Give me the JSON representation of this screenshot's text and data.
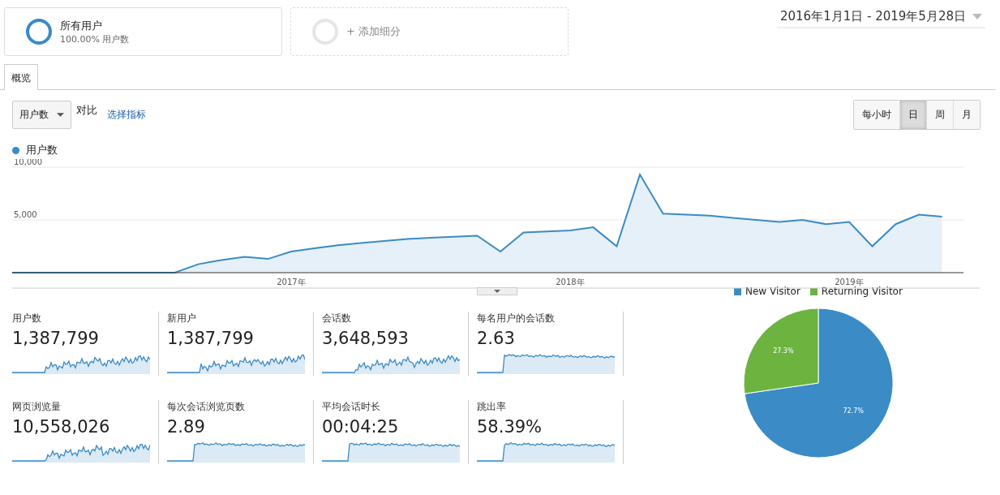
{
  "segments": [
    {
      "kind": "active",
      "title": "所有用户",
      "subtitle": "100.00% 用户数"
    },
    {
      "kind": "add",
      "title": "+ 添加细分"
    }
  ],
  "date_range": "2016年1月1日 - 2019年5月28日",
  "tabs": [
    {
      "label": "概览",
      "selected": true
    }
  ],
  "metric_dropdown": "用户数",
  "compare_label": "对比",
  "select_metric_link": "选择指标",
  "granularity": [
    {
      "label": "每小时",
      "selected": false
    },
    {
      "label": "日",
      "selected": true
    },
    {
      "label": "周",
      "selected": false
    },
    {
      "label": "月",
      "selected": false
    }
  ],
  "main_chart": {
    "chart_data": {
      "type": "area",
      "x": [
        2016,
        2016.083,
        2016.167,
        2016.25,
        2016.333,
        2016.417,
        2016.5,
        2016.583,
        2016.667,
        2016.75,
        2016.833,
        2016.917,
        2017,
        2017.083,
        2017.167,
        2017.25,
        2017.333,
        2017.417,
        2017.5,
        2017.583,
        2017.667,
        2017.75,
        2017.833,
        2017.917,
        2018,
        2018.083,
        2018.167,
        2018.25,
        2018.333,
        2018.417,
        2018.5,
        2018.583,
        2018.667,
        2018.75,
        2018.833,
        2018.917,
        2019,
        2019.083,
        2019.167,
        2019.25,
        2019.333
      ],
      "series": [
        {
          "name": "用户数",
          "color": "#3a8bc6",
          "values": [
            0,
            0,
            0,
            0,
            0,
            0,
            0,
            0,
            800,
            1200,
            1500,
            1300,
            2000,
            2300,
            2600,
            2800,
            3000,
            3200,
            3300,
            3400,
            3500,
            2000,
            3800,
            3900,
            4000,
            4300,
            2500,
            9300,
            5600,
            5500,
            5400,
            5200,
            5000,
            4800,
            5000,
            4600,
            4800,
            2500,
            4600,
            5500,
            5300
          ]
        }
      ],
      "xlim": [
        2016,
        2019.41
      ],
      "ylim": [
        0,
        10000
      ],
      "xticks": [
        {
          "value": 2017,
          "label": "2017年"
        },
        {
          "value": 2018,
          "label": "2018年"
        },
        {
          "value": 2019,
          "label": "2019年"
        }
      ],
      "yticks": [
        {
          "value": 5000,
          "label": "5,000"
        },
        {
          "value": 10000,
          "label": "10,000"
        }
      ]
    }
  },
  "metrics": [
    {
      "label": "用户数",
      "value": "1,387,799",
      "kind": "growth"
    },
    {
      "label": "新用户",
      "value": "1,387,799",
      "kind": "growth"
    },
    {
      "label": "会话数",
      "value": "3,648,593",
      "kind": "growth"
    },
    {
      "label": "每名用户的会话数",
      "value": "2.63",
      "kind": "step"
    },
    {
      "label": "网页浏览量",
      "value": "10,558,026",
      "kind": "growth"
    },
    {
      "label": "每次会话浏览页数",
      "value": "2.89",
      "kind": "step"
    },
    {
      "label": "平均会话时长",
      "value": "00:04:25",
      "kind": "step"
    },
    {
      "label": "跳出率",
      "value": "58.39%",
      "kind": "step"
    }
  ],
  "pie": {
    "chart_data": {
      "type": "pie",
      "categories": [
        "New Visitor",
        "Returning Visitor"
      ],
      "series": [
        {
          "values": [
            72.7,
            27.3
          ]
        }
      ],
      "colors": [
        "#3a8bc6",
        "#6cb33f"
      ],
      "value_labels": [
        "72.7%",
        "27.3%"
      ]
    }
  }
}
